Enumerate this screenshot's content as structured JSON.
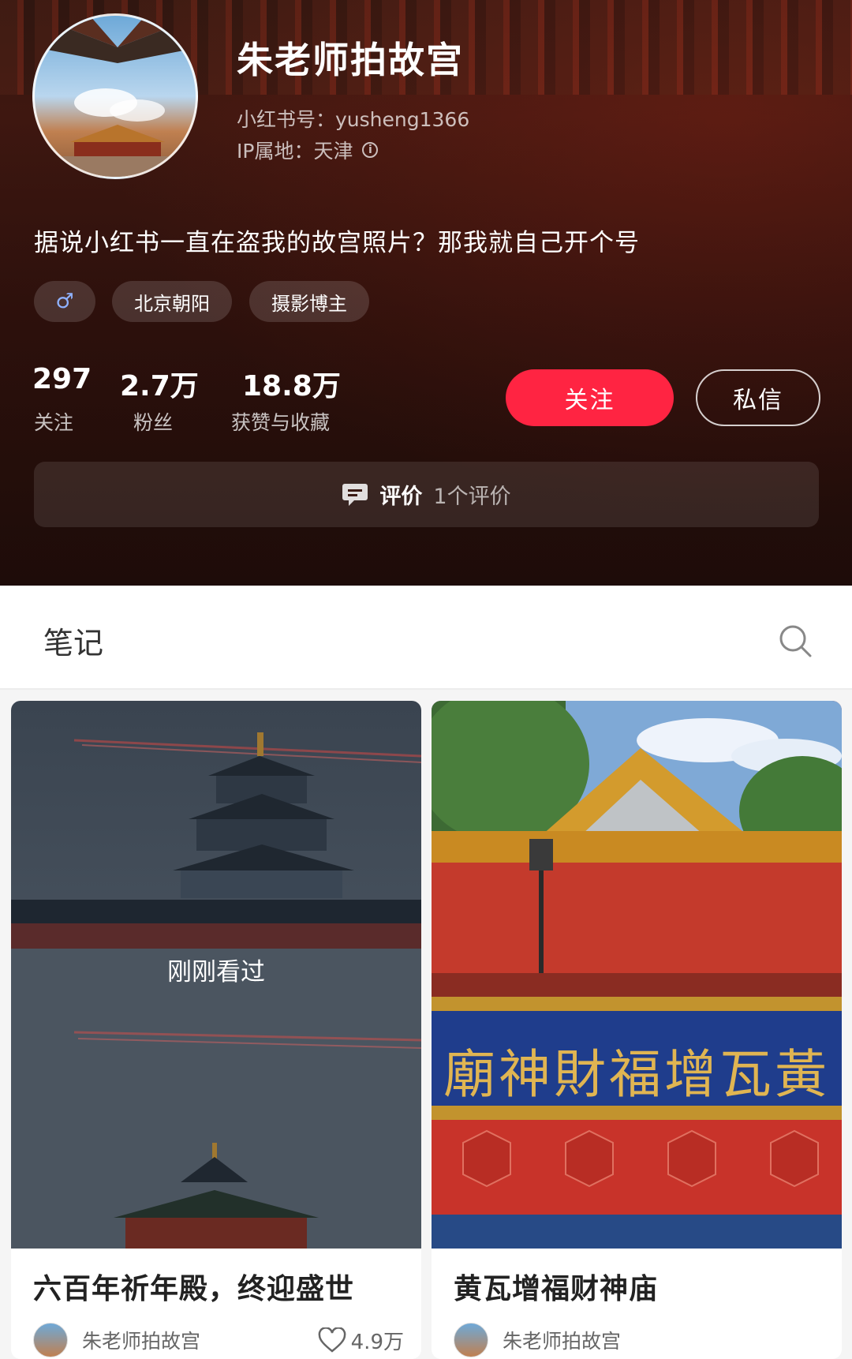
{
  "profile": {
    "name": "朱老师拍故宫",
    "account_id": "小红书号：yusheng1366",
    "ip_location": "IP属地：天津",
    "bio": "据说小红书一直在盗我的故宫照片？那我就自己开个号",
    "tags": {
      "gender": "♂",
      "location": "北京朝阳",
      "role": "摄影博主"
    },
    "stats": [
      {
        "value": "297",
        "label": "关注"
      },
      {
        "value": "2.7万",
        "label": "粉丝"
      },
      {
        "value": "18.8万",
        "label": "获赞与收藏"
      }
    ],
    "follow_label": "关注",
    "message_label": "私信",
    "review": {
      "title": "评价",
      "count": "1个评价"
    }
  },
  "notes": {
    "section_title": "笔记",
    "cards": [
      {
        "title": "六百年祈年殿，终迎盛世",
        "author": "朱老师拍故宫",
        "likes": "4.9万",
        "overlay": "刚刚看过"
      },
      {
        "title": "黄瓦增福财神庙",
        "author": "朱老师拍故宫",
        "plaque": "廟神財福增瓦黃"
      }
    ]
  },
  "colors": {
    "accent": "#ff2442",
    "header_bg": "#3a150f"
  }
}
